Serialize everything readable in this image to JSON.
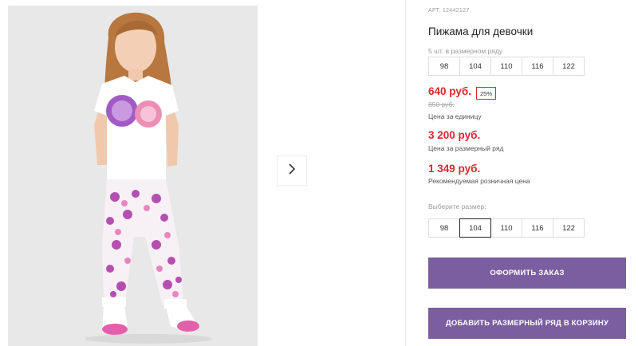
{
  "product": {
    "sku_label": "АРТ. 12442127",
    "title": "Пижама для девочки"
  },
  "size_row": {
    "label": "5 шт. в размерном ряду",
    "sizes": [
      "98",
      "104",
      "110",
      "116",
      "122"
    ]
  },
  "pricing": {
    "unit_price": "640 руб.",
    "discount": "25%",
    "old_price": "850 руб.",
    "unit_caption": "Цена за единицу",
    "row_price": "3 200 руб.",
    "row_caption": "Цена за размерный ряд",
    "retail_price": "1 349 руб.",
    "retail_caption": "Рекомендуемая розничная цена"
  },
  "size_select": {
    "label": "Выберите размер:",
    "sizes": [
      "98",
      "104",
      "110",
      "116",
      "122"
    ],
    "selected": "104"
  },
  "actions": {
    "order_label": "ОФОРМИТЬ ЗАКАЗ",
    "add_row_label": "ДОБАВИТЬ РАЗМЕРНЫЙ РЯД В КОРЗИНУ"
  },
  "gallery": {
    "next_icon": "chevron-right-icon"
  },
  "colors": {
    "accent": "#7b5ea0",
    "price": "#e1262c"
  }
}
